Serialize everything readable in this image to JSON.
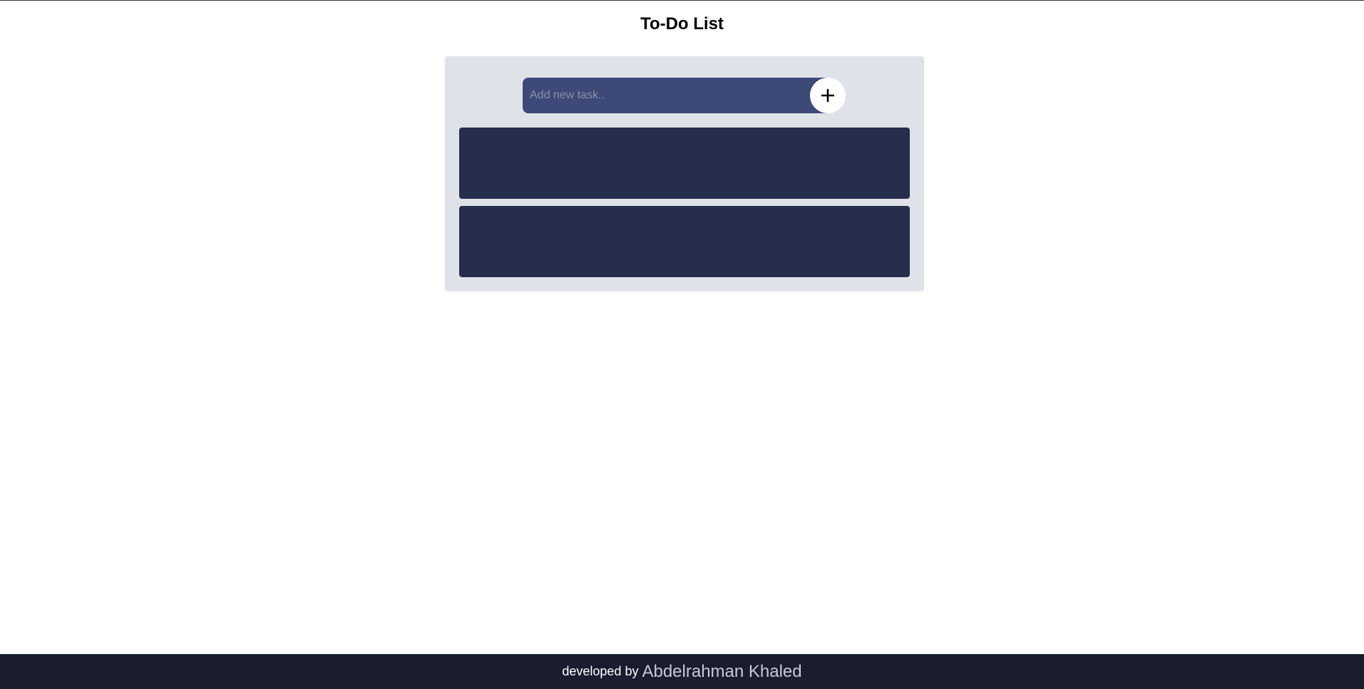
{
  "page": {
    "title": "To-Do List"
  },
  "task_input": {
    "placeholder": "Add new task..",
    "value": ""
  },
  "add_button": {
    "icon": "plus-icon"
  },
  "tasks": [
    {
      "text": ""
    },
    {
      "text": ""
    }
  ],
  "footer": {
    "prefix": "developed by",
    "author": "Abdelrahman Khaled"
  },
  "colors": {
    "panel_bg": "#dfe2e8",
    "input_bg": "#3d4a78",
    "task_bg": "#272e4c",
    "footer_bg": "#191d2e"
  }
}
